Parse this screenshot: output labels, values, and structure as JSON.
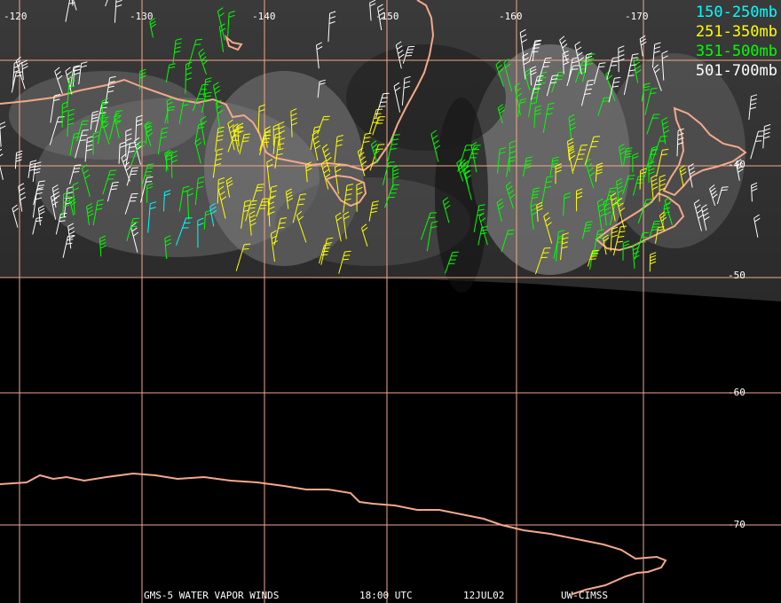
{
  "map": {
    "colors": {
      "grid": "#f4a88a",
      "coast": "#f4a88a",
      "background": "#000000",
      "label": "#ffffff"
    },
    "longitude_labels": [
      "-120",
      "-130",
      "-140",
      "-150",
      "-160",
      "-170"
    ],
    "latitude_labels": [
      "-40",
      "-50",
      "-60",
      "-70"
    ]
  },
  "legend": [
    {
      "label": "150-250mb",
      "color": "#00ffff"
    },
    {
      "label": "251-350mb",
      "color": "#ffff00"
    },
    {
      "label": "351-500mb",
      "color": "#00ff00"
    },
    {
      "label": "501-700mb",
      "color": "#ffffff"
    }
  ],
  "footer": {
    "product": "GMS-5 WATER VAPOR WINDS",
    "time": "18:00 UTC",
    "date": "12JUL02",
    "source": "UW-CIMSS"
  }
}
